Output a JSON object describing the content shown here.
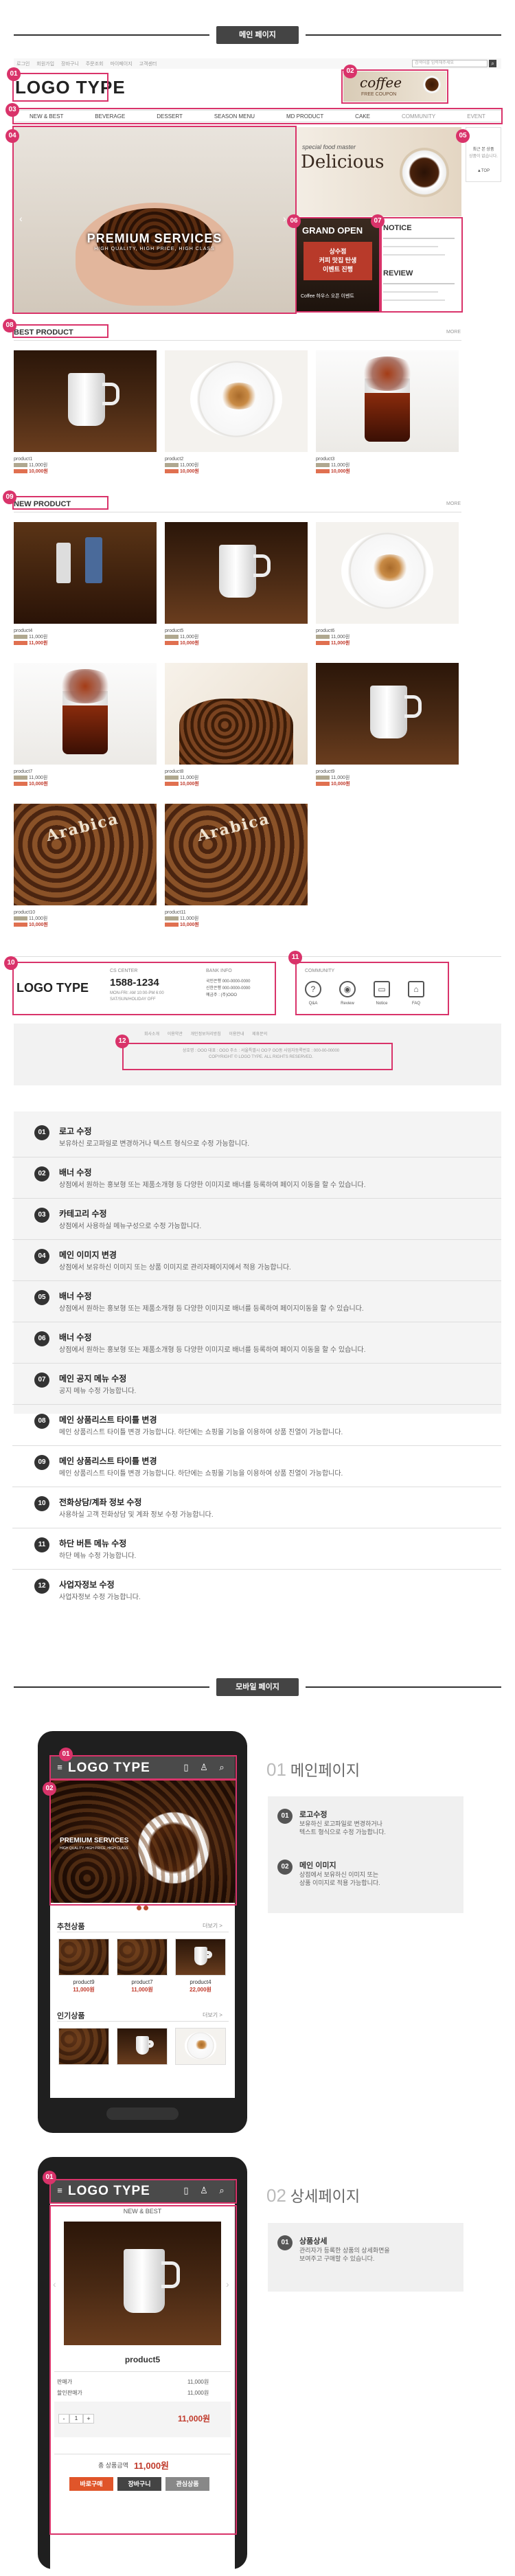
{
  "sections": {
    "main": "메인 페이지",
    "mobile": "모바일 페이지"
  },
  "markers": [
    "01",
    "02",
    "03",
    "04",
    "05",
    "06",
    "07",
    "08",
    "09",
    "10",
    "11",
    "12"
  ],
  "site": {
    "top_links": [
      "로그인",
      "회원가입",
      "장바구니",
      "주문조회",
      "마이페이지",
      "고객센터"
    ],
    "search_placeholder": "검색어를 입력해주세요",
    "logo": "LOGO TYPE",
    "banner": {
      "title": "coffee",
      "sub": "FREE COUPON"
    },
    "nav": [
      "NEW & BEST",
      "BEVERAGE",
      "DESSERT",
      "SEASON MENU",
      "MD PRODUCT",
      "CAKE",
      "COMMUNITY",
      "EVENT"
    ],
    "hero": {
      "title": "PREMIUM SERVICES",
      "sub": "HIGH QUALITY, HIGH PRICE, HIGH CLASS"
    },
    "promo": {
      "script": "special food master",
      "title": "Delicious"
    },
    "grand_open": {
      "title": "GRAND OPEN",
      "line1": "상수점",
      "line2": "커피 맛집 탄생",
      "line3": "이벤트 진행",
      "line4": "Coffee 하우스 오픈 이벤트"
    },
    "notice_title": "NOTICE",
    "review_title": "REVIEW",
    "quick": {
      "label": "최근 본 상품",
      "line": "상품이 없습니다.",
      "top": "▲TOP"
    },
    "best_title": "BEST PRODUCT",
    "new_title": "NEW PRODUCT",
    "more": "MORE",
    "best_items": [
      {
        "name": "product1",
        "price": "11,000원",
        "sale": "10,000원"
      },
      {
        "name": "product2",
        "price": "11,000원",
        "sale": "10,000원"
      },
      {
        "name": "product3",
        "price": "11,000원",
        "sale": "10,000원"
      }
    ],
    "new_items": [
      {
        "name": "product4",
        "price": "11,000원",
        "sale": "11,000원"
      },
      {
        "name": "product5",
        "price": "11,000원",
        "sale": "10,000원"
      },
      {
        "name": "product6",
        "price": "11,000원",
        "sale": "11,000원"
      },
      {
        "name": "product7",
        "price": "11,000원",
        "sale": "10,000원"
      },
      {
        "name": "product8",
        "price": "11,000원",
        "sale": "10,000원"
      },
      {
        "name": "product9",
        "price": "11,000원",
        "sale": "10,000원"
      },
      {
        "name": "product10",
        "price": "11,000원",
        "sale": "10,000원"
      },
      {
        "name": "product11",
        "price": "11,000원",
        "sale": "10,000원"
      }
    ],
    "arabica": "Arabica",
    "footer": {
      "logo": "LOGO TYPE",
      "cs_label": "CS CENTER",
      "cs_phone": "1588-1234",
      "cs_lines": [
        "MON-FRI: AM 10:00-PM 6:00",
        "SAT/SUN/HOLIDAY OFF"
      ],
      "bank_label": "BANK INFO",
      "bank_lines": [
        "국민은행 000-0000-0000",
        "신한은행 000-0000-0000",
        "예금주 : (주)OOO"
      ],
      "community_label": "COMMUNITY",
      "community": [
        "Q&A",
        "Review",
        "Notice",
        "FAQ"
      ],
      "links": [
        "회사소개",
        "이용약관",
        "개인정보처리방침",
        "이용안내",
        "제휴문의"
      ],
      "address": "상호명 : OOO  대표 : OOO  주소 : 서울특별시 OO구 OO동  사업자등록번호 : 000-00-00000",
      "copyright": "COPYRIGHT © LOGO TYPE. ALL RIGHTS RESERVED."
    }
  },
  "annotations": [
    {
      "n": "01",
      "title": "로고 수정",
      "desc": "보유하신 로고파일로 변경하거나 텍스트 형식으로 수정 가능합니다."
    },
    {
      "n": "02",
      "title": "배너 수정",
      "desc": "상점에서 원하는 홍보형 또는 제품소개형 등 다양한 이미지로 배너를 등록하여 페이지 이동을 할 수 있습니다."
    },
    {
      "n": "03",
      "title": "카테고리 수정",
      "desc": "상점에서 사용하실 메뉴구성으로 수정 가능합니다."
    },
    {
      "n": "04",
      "title": "메인 이미지 변경",
      "desc": "상점에서 보유하신 이미지 또는 상품 이미지로 관리자페이지에서 적용 가능합니다."
    },
    {
      "n": "05",
      "title": "배너 수정",
      "desc": "상점에서 원하는 홍보형 또는 제품소개형 등 다양한 이미지로 배너를 등록하여 페이지이동을 할 수 있습니다."
    },
    {
      "n": "06",
      "title": "배너 수정",
      "desc": "상점에서 원하는 홍보형 또는 제품소개형 등 다양한 이미지로 배너를 등록하여 페이지 이동을 할 수 있습니다."
    },
    {
      "n": "07",
      "title": "메인 공지 메뉴 수정",
      "desc": "공지 메뉴 수정 가능합니다."
    },
    {
      "n": "08",
      "title": "메인 상품리스트 타이틀 변경",
      "desc": "메인 상품리스트 타이틀 변경 가능합니다. 하단에는 쇼핑몰 기능을 이용하여 상품 진열이 가능합니다."
    },
    {
      "n": "09",
      "title": "메인 상품리스트 타이틀 변경",
      "desc": "메인 상품리스트 타이틀 변경 가능합니다. 하단에는 쇼핑몰 기능을 이용하여 상품 진열이 가능합니다."
    },
    {
      "n": "10",
      "title": "전화상담/계좌 정보 수정",
      "desc": "사용하실 고객 전화상담 및 계좌 정보 수정 가능합니다."
    },
    {
      "n": "11",
      "title": "하단 버튼 메뉴 수정",
      "desc": "하단 메뉴 수정 가능합니다."
    },
    {
      "n": "12",
      "title": "사업자정보 수정",
      "desc": "사업자정보 수정 가능합니다."
    }
  ],
  "mobile1": {
    "logo": "LOGO TYPE",
    "hero": "PREMIUM SERVICES",
    "hero_sub": "HIGH QUALITY, HIGH PRICE, HIGH CLASS",
    "rec_title": "추천상품",
    "pop_title": "인기상품",
    "more": "더보기 >",
    "rec_items": [
      {
        "name": "product9",
        "price": "11,000원"
      },
      {
        "name": "product7",
        "price": "11,000원"
      },
      {
        "name": "product4",
        "price": "22,000원"
      }
    ],
    "heading": "메인페이지",
    "heading_num": "01",
    "notes": [
      {
        "n": "01",
        "title": "로고수정",
        "lines": [
          "보유하신 로고파일로 변경하거나",
          "텍스트 형식으로 수정 가능합니다."
        ]
      },
      {
        "n": "02",
        "title": "메인 이미지",
        "lines": [
          "상점에서 보유하신 이미지 또는",
          "상품 이미지로 적용 가능합니다."
        ]
      }
    ]
  },
  "mobile2": {
    "logo": "LOGO TYPE",
    "category": "NEW & BEST",
    "product_name": "product5",
    "rows": [
      {
        "label": "판매가",
        "value": "11,000원"
      },
      {
        "label": "할인판매가",
        "value": "11,000원"
      }
    ],
    "qty": "1",
    "qty_minus": "-",
    "qty_plus": "+",
    "line_total": "11,000원",
    "total_label": "총 상품금액",
    "total": "11,000원",
    "buttons": [
      "바로구매",
      "장바구니",
      "관심상품"
    ],
    "heading": "상세페이지",
    "heading_num": "02",
    "notes": [
      {
        "n": "01",
        "title": "상품상세",
        "lines": [
          "관리자가 등록한 상품의 상세화면을",
          "보여주고 구매할 수 있습니다."
        ]
      }
    ]
  },
  "colors": {
    "accent": "#d9336a",
    "dark": "#333333",
    "price": "#c03a2b"
  }
}
